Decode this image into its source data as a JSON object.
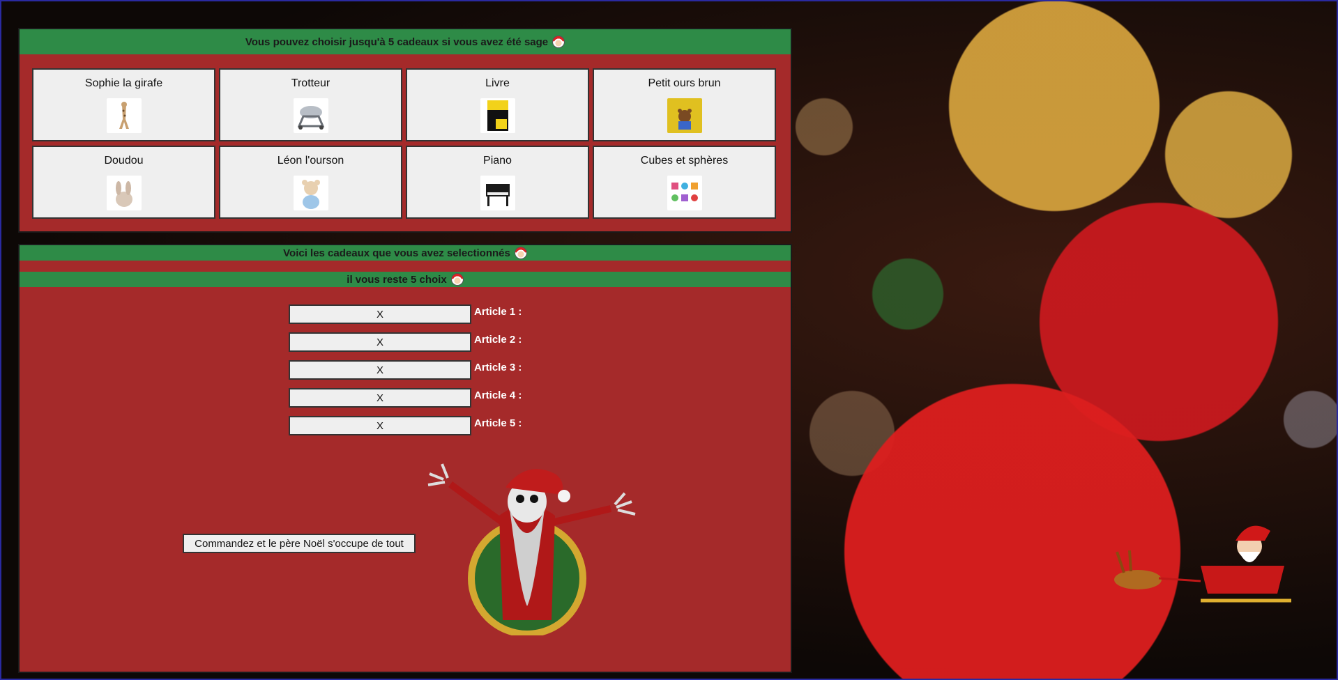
{
  "gifts_panel": {
    "header": "Vous pouvez choisir jusqu'à 5 cadeaux si vous avez été sage",
    "items": [
      {
        "label": "Sophie la girafe",
        "icon": "giraffe-toy-icon",
        "color": "#c8a070"
      },
      {
        "label": "Trotteur",
        "icon": "baby-walker-icon",
        "color": "#9aa0a8"
      },
      {
        "label": "Livre",
        "icon": "book-icon",
        "color": "#f2d21a"
      },
      {
        "label": "Petit ours brun",
        "icon": "bear-book-icon",
        "color": "#e0c020"
      },
      {
        "label": "Doudou",
        "icon": "plush-rabbit-icon",
        "color": "#d9c8b8"
      },
      {
        "label": "Léon l'ourson",
        "icon": "teddy-bear-icon",
        "color": "#e8d0b0"
      },
      {
        "label": "Piano",
        "icon": "piano-icon",
        "color": "#1a1a1a"
      },
      {
        "label": "Cubes et sphères",
        "icon": "cubes-spheres-icon",
        "color": "#e05080"
      }
    ]
  },
  "selection_panel": {
    "header": "Voici les cadeaux que vous avez selectionnés",
    "remaining": "il vous reste 5 choix",
    "articles": [
      {
        "button": "X",
        "label": "Article 1 :"
      },
      {
        "button": "X",
        "label": "Article 2 :"
      },
      {
        "button": "X",
        "label": "Article 3 :"
      },
      {
        "button": "X",
        "label": "Article 4 :"
      },
      {
        "button": "X",
        "label": "Article 5 :"
      }
    ],
    "order_button": "Commandez et le père Noël s'occupe de tout"
  },
  "colors": {
    "panel_red": "#a52a2a",
    "header_green": "#2e8b47",
    "card_bg": "#efefef"
  }
}
